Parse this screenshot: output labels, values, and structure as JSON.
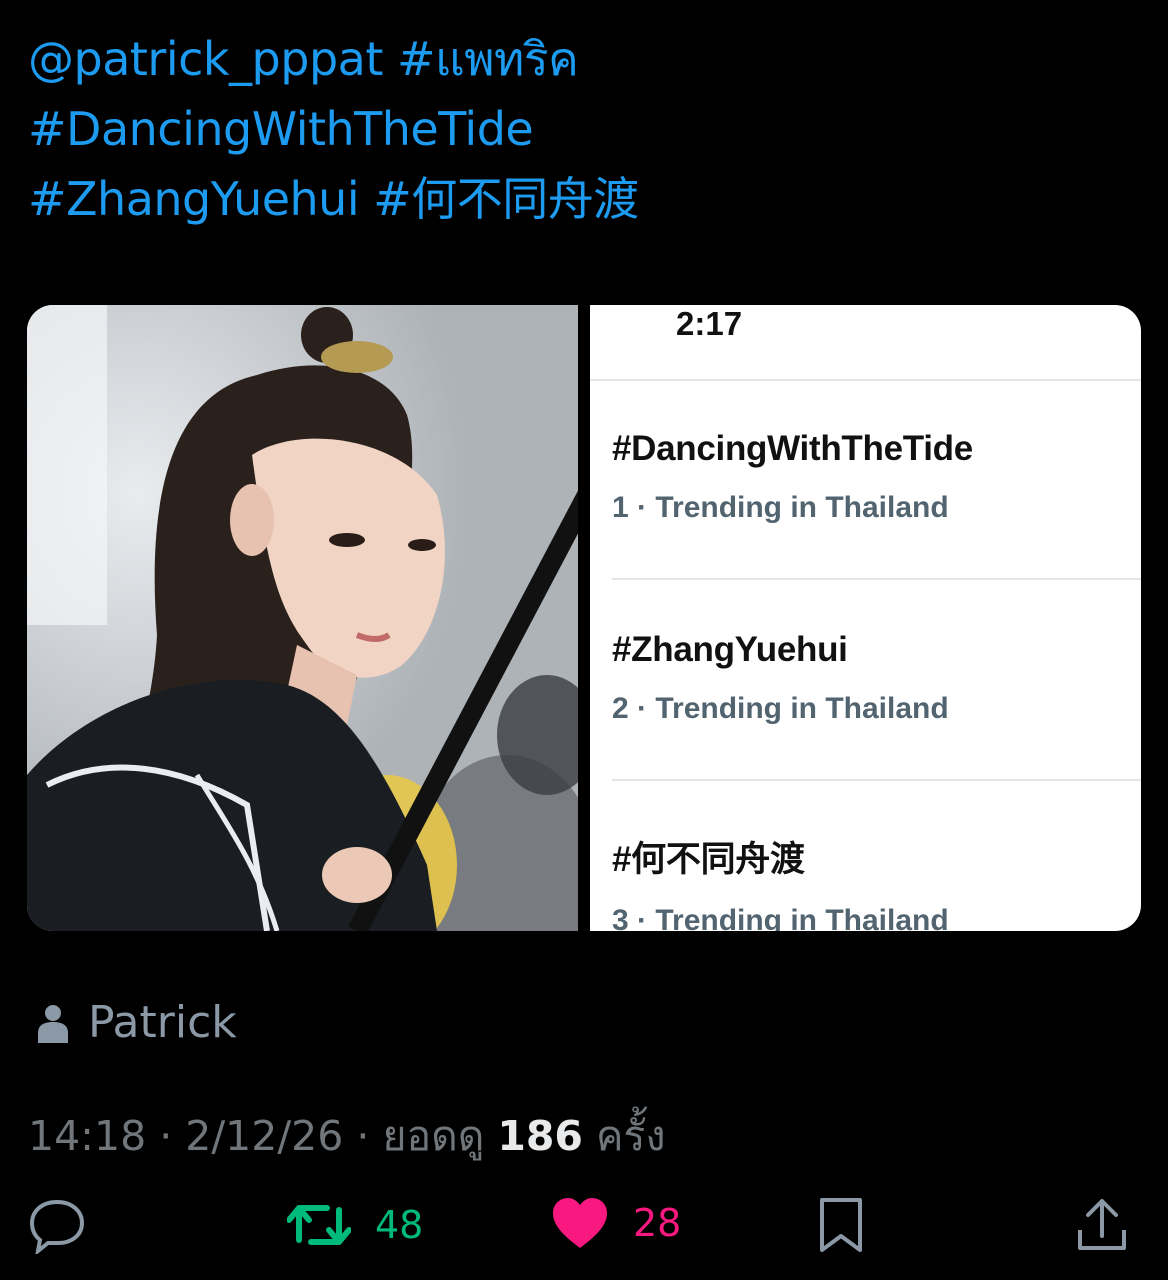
{
  "tweet": {
    "lines": [
      [
        "@patrick_pppat",
        "#แพทริค"
      ],
      [
        "#DancingWithTheTide"
      ],
      [
        "#ZhangYuehui",
        "#何不同舟渡"
      ]
    ]
  },
  "media": {
    "screenshot_time": "2:17",
    "trends": [
      {
        "tag": "#DancingWithTheTide",
        "meta": "1 · Trending in Thailand"
      },
      {
        "tag": "#ZhangYuehui",
        "meta": "2 · Trending in Thailand"
      },
      {
        "tag": "#何不同舟渡",
        "meta": "3 · Trending in Thailand"
      }
    ]
  },
  "author": {
    "name": "Patrick",
    "icon": "person-icon"
  },
  "meta": {
    "time": "14:18",
    "sep1": " · ",
    "date": "2/12/26",
    "sep2": " · ",
    "views_prefix": "ยอดดู ",
    "views": "186",
    "views_suffix": " ครั้ง"
  },
  "actions": {
    "reply": {
      "icon": "reply-icon"
    },
    "retweet": {
      "icon": "retweet-icon",
      "count": "48",
      "color": "#00ba7c"
    },
    "like": {
      "icon": "heart-icon",
      "count": "28",
      "color": "#f91880"
    },
    "bookmark": {
      "icon": "bookmark-icon"
    },
    "share": {
      "icon": "share-icon"
    }
  },
  "colors": {
    "link": "#1d9bf0",
    "background": "#000000",
    "muted": "#71767b"
  }
}
